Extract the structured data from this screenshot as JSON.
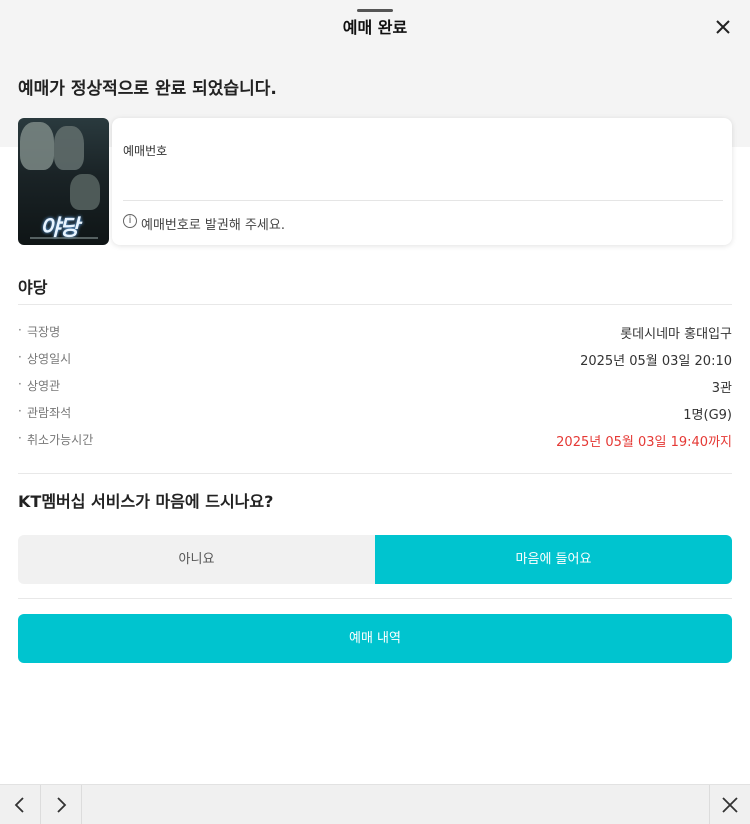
{
  "header": {
    "title": "예매 완료"
  },
  "message": "예매가 정상적으로 완료 되었습니다.",
  "ticket": {
    "label": "예매번호",
    "note": "예매번호로 발권해 주세요.",
    "info_icon_glyph": "i"
  },
  "poster": {
    "title_art": "야당"
  },
  "movie": {
    "title": "야당",
    "details": [
      {
        "label": "극장명",
        "value": "롯데시네마 홍대입구"
      },
      {
        "label": "상영일시",
        "value": "2025년 05월 03일 20:10"
      },
      {
        "label": "상영관",
        "value": "3관"
      },
      {
        "label": "관람좌석",
        "value": "1명(G9)"
      },
      {
        "label": "취소가능시간",
        "value": "2025년 05월 03일 19:40까지"
      }
    ]
  },
  "survey": {
    "question": "KT멤버십 서비스가 마음에 드시나요?",
    "no_label": "아니요",
    "yes_label": "마음에 들어요"
  },
  "history_button": "예매 내역",
  "bullet": "·",
  "colors": {
    "accent": "#00c4cf",
    "warning": "#e53935"
  },
  "icons": {
    "close": "close-icon",
    "back": "chevron-left-icon",
    "forward": "chevron-right-icon",
    "info": "info-icon"
  }
}
